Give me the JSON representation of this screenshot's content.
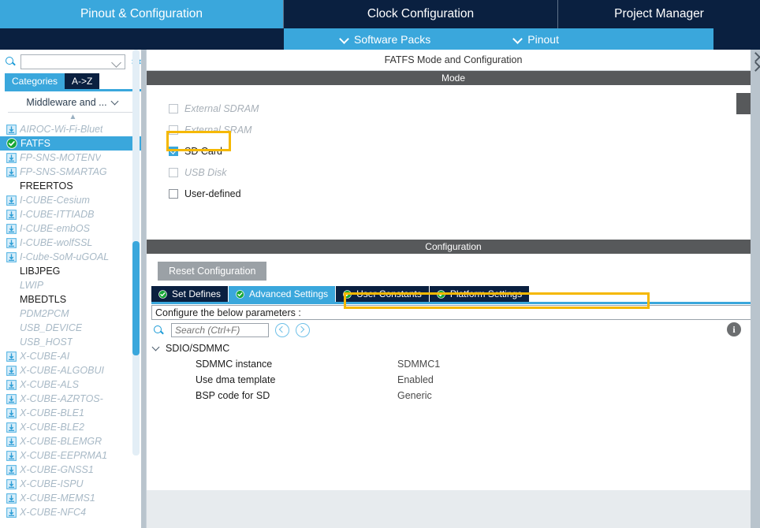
{
  "topbar": {
    "tabs": [
      {
        "label": "Pinout & Configuration",
        "active": true
      },
      {
        "label": "Clock Configuration",
        "active": false
      },
      {
        "label": "Project Manager",
        "active": false
      }
    ],
    "subitems": [
      {
        "label": "Software Packs",
        "icon": "chevron-down-icon"
      },
      {
        "label": "Pinout",
        "icon": "chevron-down-icon"
      }
    ]
  },
  "sidebar": {
    "search": {
      "value": "",
      "placeholder": ""
    },
    "gear_icon": "gear-icon",
    "search_icon": "search-icon",
    "view_tabs": [
      {
        "label": "Categories",
        "active": true
      },
      {
        "label": "A->Z",
        "active": false
      }
    ],
    "group_label": "Middleware and ...",
    "items": [
      {
        "label": "AIROC-Wi-Fi-Bluet",
        "icon": "download-icon",
        "state": "disabled"
      },
      {
        "label": "FATFS",
        "icon": "check-circle-icon",
        "state": "selected"
      },
      {
        "label": "FP-SNS-MOTENV",
        "icon": "download-icon",
        "state": "disabled"
      },
      {
        "label": "FP-SNS-SMARTAG",
        "icon": "download-icon",
        "state": "disabled"
      },
      {
        "label": "FREERTOS",
        "icon": "none",
        "state": "enabled"
      },
      {
        "label": "I-CUBE-Cesium",
        "icon": "download-icon",
        "state": "disabled"
      },
      {
        "label": "I-CUBE-ITTIADB",
        "icon": "download-icon",
        "state": "disabled"
      },
      {
        "label": "I-CUBE-embOS",
        "icon": "download-icon",
        "state": "disabled"
      },
      {
        "label": "I-CUBE-wolfSSL",
        "icon": "download-icon",
        "state": "disabled"
      },
      {
        "label": "I-Cube-SoM-uGOAL",
        "icon": "download-icon",
        "state": "disabled"
      },
      {
        "label": "LIBJPEG",
        "icon": "none",
        "state": "enabled"
      },
      {
        "label": "LWIP",
        "icon": "none",
        "state": "disabled"
      },
      {
        "label": "MBEDTLS",
        "icon": "none",
        "state": "enabled"
      },
      {
        "label": "PDM2PCM",
        "icon": "none",
        "state": "disabled"
      },
      {
        "label": "USB_DEVICE",
        "icon": "none",
        "state": "disabled"
      },
      {
        "label": "USB_HOST",
        "icon": "none",
        "state": "disabled"
      },
      {
        "label": "X-CUBE-AI",
        "icon": "download-icon",
        "state": "disabled"
      },
      {
        "label": "X-CUBE-ALGOBUI",
        "icon": "download-icon",
        "state": "disabled"
      },
      {
        "label": "X-CUBE-ALS",
        "icon": "download-icon",
        "state": "disabled"
      },
      {
        "label": "X-CUBE-AZRTOS-",
        "icon": "download-icon",
        "state": "disabled"
      },
      {
        "label": "X-CUBE-BLE1",
        "icon": "download-icon",
        "state": "disabled"
      },
      {
        "label": "X-CUBE-BLE2",
        "icon": "download-icon",
        "state": "disabled"
      },
      {
        "label": "X-CUBE-BLEMGR",
        "icon": "download-icon",
        "state": "disabled"
      },
      {
        "label": "X-CUBE-EEPRMA1",
        "icon": "download-icon",
        "state": "disabled"
      },
      {
        "label": "X-CUBE-GNSS1",
        "icon": "download-icon",
        "state": "disabled"
      },
      {
        "label": "X-CUBE-ISPU",
        "icon": "download-icon",
        "state": "disabled"
      },
      {
        "label": "X-CUBE-MEMS1",
        "icon": "download-icon",
        "state": "disabled"
      },
      {
        "label": "X-CUBE-NFC4",
        "icon": "download-icon",
        "state": "disabled"
      }
    ]
  },
  "main": {
    "panel_title": "FATFS Mode and Configuration",
    "mode": {
      "header": "Mode",
      "options": [
        {
          "label": "External SDRAM",
          "checked": false,
          "disabled": true
        },
        {
          "label": "External SRAM",
          "checked": false,
          "disabled": true
        },
        {
          "label": "SD Card",
          "checked": true,
          "disabled": false,
          "highlighted": true
        },
        {
          "label": "USB Disk",
          "checked": false,
          "disabled": true
        },
        {
          "label": "User-defined",
          "checked": false,
          "disabled": false
        }
      ]
    },
    "configuration": {
      "header": "Configuration",
      "reset_label": "Reset Configuration",
      "tabs": [
        {
          "label": "Set Defines",
          "active": false,
          "icon": "check-circle-icon"
        },
        {
          "label": "Advanced Settings",
          "active": true,
          "icon": "check-circle-icon"
        },
        {
          "label": "User Constants",
          "active": false,
          "icon": "check-circle-icon"
        },
        {
          "label": "Platform Settings",
          "active": false,
          "icon": "check-circle-icon"
        }
      ],
      "note": "Configure the below parameters :",
      "search": {
        "value": "",
        "placeholder": "Search (Ctrl+F)"
      },
      "nav_prev_icon": "chevron-left-circle-icon",
      "nav_next_icon": "chevron-right-circle-icon",
      "info_icon": "info-icon",
      "info_label": "i",
      "tree": {
        "group": "SDIO/SDMMC",
        "rows": [
          {
            "name": "SDMMC instance",
            "value": "SDMMC1",
            "highlighted": false
          },
          {
            "name": "Use dma template",
            "value": "Enabled",
            "highlighted": true
          },
          {
            "name": "BSP code for SD",
            "value": "Generic",
            "highlighted": false
          }
        ]
      }
    }
  },
  "colors": {
    "accent_blue": "#3aa7dc",
    "dark_navy": "#0a2040",
    "highlight_yellow": "#f5b800",
    "section_gray": "#57595b"
  }
}
